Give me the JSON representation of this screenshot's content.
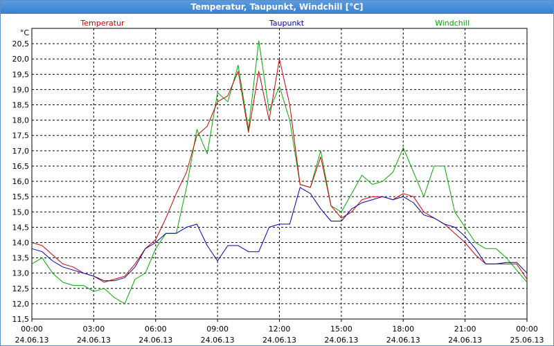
{
  "window": {
    "title": "Temperatur, Taupunkt, Windchill [°C]"
  },
  "chart_data": {
    "type": "line",
    "title": "Temperatur, Taupunkt, Windchill [°C]",
    "ylabel": "°C",
    "ylim": [
      11.5,
      21.0
    ],
    "yticks": [
      "11,5",
      "12,0",
      "12,5",
      "13,0",
      "13,5",
      "14,0",
      "14,5",
      "15,0",
      "15,5",
      "16,0",
      "16,5",
      "17,0",
      "17,5",
      "18,0",
      "18,5",
      "19,0",
      "19,5",
      "20,0",
      "20,5"
    ],
    "xticks": [
      {
        "time": "00:00",
        "date": "24.06.13"
      },
      {
        "time": "03:00",
        "date": "24.06.13"
      },
      {
        "time": "06:00",
        "date": "24.06.13"
      },
      {
        "time": "09:00",
        "date": "24.06.13"
      },
      {
        "time": "12:00",
        "date": "24.06.13"
      },
      {
        "time": "15:00",
        "date": "24.06.13"
      },
      {
        "time": "18:00",
        "date": "24.06.13"
      },
      {
        "time": "21:00",
        "date": "24.06.13"
      },
      {
        "time": "00:00",
        "date": "25.06.13"
      }
    ],
    "grid": true,
    "legend_position": "top",
    "series": [
      {
        "name": "Temperatur",
        "color": "#cc0000",
        "x": [
          0,
          0.5,
          1,
          1.5,
          2,
          2.5,
          3,
          3.5,
          4,
          4.5,
          5,
          5.5,
          6,
          6.5,
          7,
          7.5,
          8,
          8.5,
          9,
          9.5,
          10,
          10.5,
          11,
          11.5,
          12,
          12.5,
          13,
          13.5,
          14,
          14.5,
          15,
          15.5,
          16,
          16.5,
          17,
          17.5,
          18,
          18.5,
          19,
          19.5,
          20,
          20.5,
          21,
          21.5,
          22,
          22.5,
          23,
          23.5,
          24
        ],
        "values": [
          14.0,
          13.9,
          13.6,
          13.3,
          13.2,
          13.0,
          12.9,
          12.7,
          12.8,
          12.9,
          13.3,
          13.8,
          14.1,
          14.8,
          15.6,
          16.3,
          17.5,
          17.8,
          18.6,
          18.8,
          19.6,
          17.6,
          19.6,
          18.0,
          20.0,
          18.5,
          15.9,
          15.8,
          16.8,
          15.2,
          14.8,
          15.0,
          15.4,
          15.5,
          15.5,
          15.4,
          15.6,
          15.5,
          15.0,
          14.8,
          14.6,
          14.3,
          14.0,
          13.6,
          13.3,
          13.3,
          13.3,
          13.3,
          12.8
        ]
      },
      {
        "name": "Taupunkt",
        "color": "#0000aa",
        "x": [
          0,
          0.5,
          1,
          1.5,
          2,
          2.5,
          3,
          3.5,
          4,
          4.5,
          5,
          5.5,
          6,
          6.5,
          7,
          7.5,
          8,
          8.5,
          9,
          9.5,
          10,
          10.5,
          11,
          11.5,
          12,
          12.5,
          13,
          13.5,
          14,
          14.5,
          15,
          15.5,
          16,
          16.5,
          17,
          17.5,
          18,
          18.5,
          19,
          19.5,
          20,
          20.5,
          21,
          21.5,
          22,
          22.5,
          23,
          23.5,
          24
        ],
        "values": [
          13.8,
          13.7,
          13.4,
          13.2,
          13.1,
          13.0,
          12.9,
          12.75,
          12.75,
          12.85,
          13.2,
          13.8,
          14.0,
          14.3,
          14.3,
          14.5,
          14.6,
          13.9,
          13.4,
          13.9,
          13.9,
          13.7,
          13.7,
          14.5,
          14.6,
          14.6,
          15.8,
          15.6,
          15.1,
          14.7,
          14.7,
          15.1,
          15.3,
          15.4,
          15.5,
          15.4,
          15.5,
          15.3,
          14.9,
          14.8,
          14.6,
          14.5,
          14.2,
          13.8,
          13.3,
          13.3,
          13.35,
          13.35,
          13.0
        ]
      },
      {
        "name": "Windchill",
        "color": "#00aa00",
        "x": [
          0,
          0.5,
          1,
          1.5,
          2,
          2.5,
          3,
          3.5,
          4,
          4.5,
          5,
          5.5,
          6,
          6.5,
          7,
          7.5,
          8,
          8.5,
          9,
          9.5,
          10,
          10.5,
          11,
          11.5,
          12,
          12.5,
          13,
          13.5,
          14,
          14.5,
          15,
          15.5,
          16,
          16.5,
          17,
          17.5,
          18,
          18.5,
          19,
          19.5,
          20,
          20.5,
          21,
          21.5,
          22,
          22.5,
          23,
          23.5,
          24
        ],
        "values": [
          13.3,
          13.5,
          13.0,
          12.7,
          12.6,
          12.6,
          12.4,
          12.5,
          12.2,
          12.0,
          12.8,
          13.0,
          13.8,
          14.3,
          14.3,
          15.8,
          17.7,
          16.9,
          18.9,
          18.6,
          19.8,
          17.7,
          20.6,
          18.3,
          19.1,
          18.0,
          15.9,
          15.8,
          17.0,
          15.2,
          15.0,
          15.6,
          16.2,
          15.9,
          16.0,
          16.3,
          17.1,
          16.3,
          15.5,
          16.5,
          16.5,
          15.0,
          14.5,
          14.0,
          13.8,
          13.8,
          13.5,
          13.1,
          12.7
        ]
      }
    ]
  }
}
